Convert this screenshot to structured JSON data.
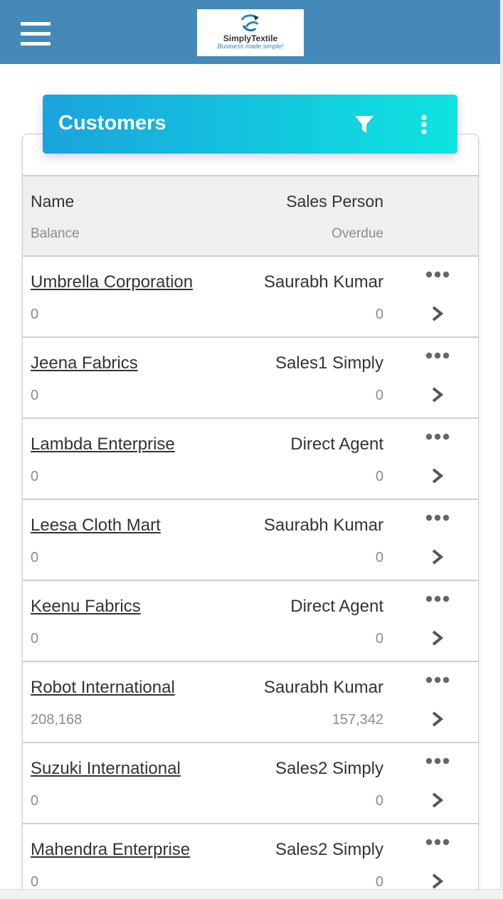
{
  "header": {
    "logo_brand": "SimplyTextile",
    "logo_tagline": "Business made simple!",
    "colors": {
      "bar": "#4589b8"
    }
  },
  "card": {
    "title": "Customers",
    "gradient": [
      "#1aa3dc",
      "#0ee4e0"
    ]
  },
  "table": {
    "columns": {
      "name": "Name",
      "sales_person": "Sales Person",
      "balance": "Balance",
      "overdue": "Overdue"
    },
    "rows": [
      {
        "name": "Umbrella Corporation",
        "sales_person": "Saurabh Kumar",
        "balance": "0",
        "overdue": "0"
      },
      {
        "name": "Jeena Fabrics",
        "sales_person": "Sales1 Simply",
        "balance": "0",
        "overdue": "0"
      },
      {
        "name": "Lambda Enterprise",
        "sales_person": "Direct Agent",
        "balance": "0",
        "overdue": "0"
      },
      {
        "name": "Leesa Cloth Mart",
        "sales_person": "Saurabh Kumar",
        "balance": "0",
        "overdue": "0"
      },
      {
        "name": "Keenu Fabrics",
        "sales_person": "Direct Agent",
        "balance": "0",
        "overdue": "0"
      },
      {
        "name": "Robot International",
        "sales_person": "Saurabh Kumar",
        "balance": "208,168",
        "overdue": "157,342"
      },
      {
        "name": "Suzuki International",
        "sales_person": "Sales2 Simply",
        "balance": "0",
        "overdue": "0"
      },
      {
        "name": "Mahendra Enterprise",
        "sales_person": "Sales2 Simply",
        "balance": "0",
        "overdue": "0"
      }
    ]
  },
  "icons": {
    "menu": "hamburger-icon",
    "filter": "filter-icon",
    "more": "more-vertical-icon",
    "row_more": "more-horizontal-icon",
    "row_open": "chevron-right-icon"
  }
}
